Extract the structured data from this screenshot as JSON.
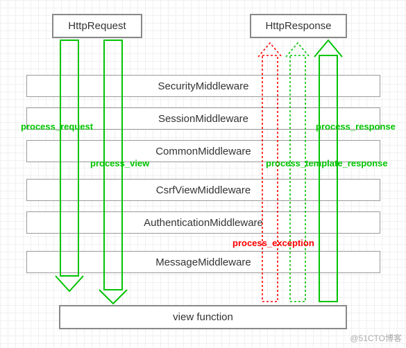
{
  "top": {
    "request": "HttpRequest",
    "response": "HttpResponse"
  },
  "middleware": [
    "SecurityMiddleware",
    "SessionMiddleware",
    "CommonMiddleware",
    "CsrfViewMiddleware",
    "AuthenticationMiddleware",
    "MessageMiddleware"
  ],
  "bottom": {
    "view": "view function"
  },
  "labels": {
    "process_request": "process_request",
    "process_view": "process_view",
    "process_exception": "process_exception",
    "process_template_response": "process_template_response",
    "process_response": "process_response"
  },
  "colors": {
    "request_arrow": "#00c400",
    "response_solid": "#00c400",
    "response_dotted_green": "#00c400",
    "response_dotted_red": "#ff0000"
  },
  "watermark": "@51CTO博客"
}
